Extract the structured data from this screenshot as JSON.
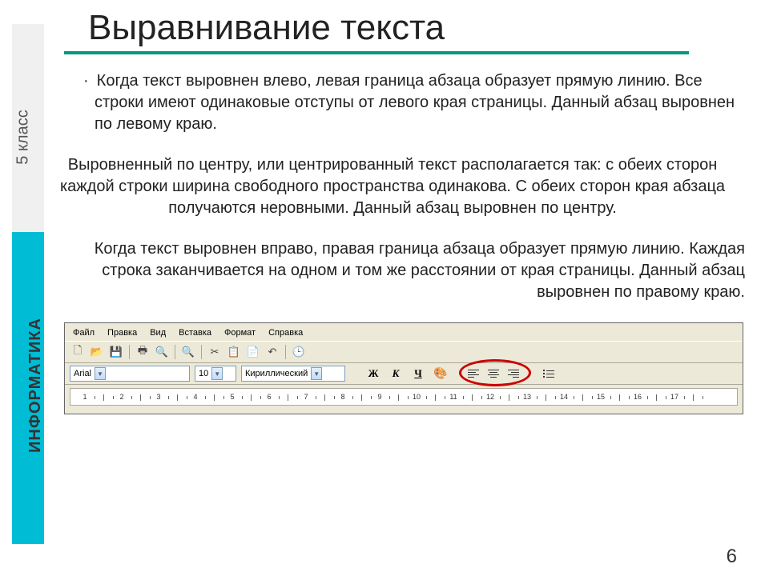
{
  "sidebar": {
    "top_label": "5 класс",
    "bottom_label": "ИНФОРМАТИКА"
  },
  "title": "Выравнивание текста",
  "paragraphs": {
    "left": "Когда текст выровнен влево, левая граница абзаца образует прямую линию. Все строки имеют одинаковые отступы от левого края страницы. Данный абзац выровнен по левому краю.",
    "center": "Выровненный по центру, или центрированный текст располагается так: с обеих сторон каждой строки ширина свободного пространства одинакова. С обеих сторон края абзаца получаются  неровными. Данный абзац выровнен по центру.",
    "right": "Когда текст выровнен вправо, правая граница абзаца образует прямую линию. Каждая строка заканчивается на одном и том же расстоянии от края страницы. Данный абзац выровнен по правому краю."
  },
  "app": {
    "menu": [
      "Файл",
      "Правка",
      "Вид",
      "Вставка",
      "Формат",
      "Справка"
    ],
    "font_name": "Arial",
    "font_size": "10",
    "charset": "Кириллический",
    "bold": "Ж",
    "italic": "К",
    "underline": "Ч",
    "ruler_numbers": [
      "1",
      "2",
      "3",
      "4",
      "5",
      "6",
      "7",
      "8",
      "9",
      "10",
      "11",
      "12",
      "13",
      "14",
      "15",
      "16",
      "17"
    ]
  },
  "page_number": "6"
}
